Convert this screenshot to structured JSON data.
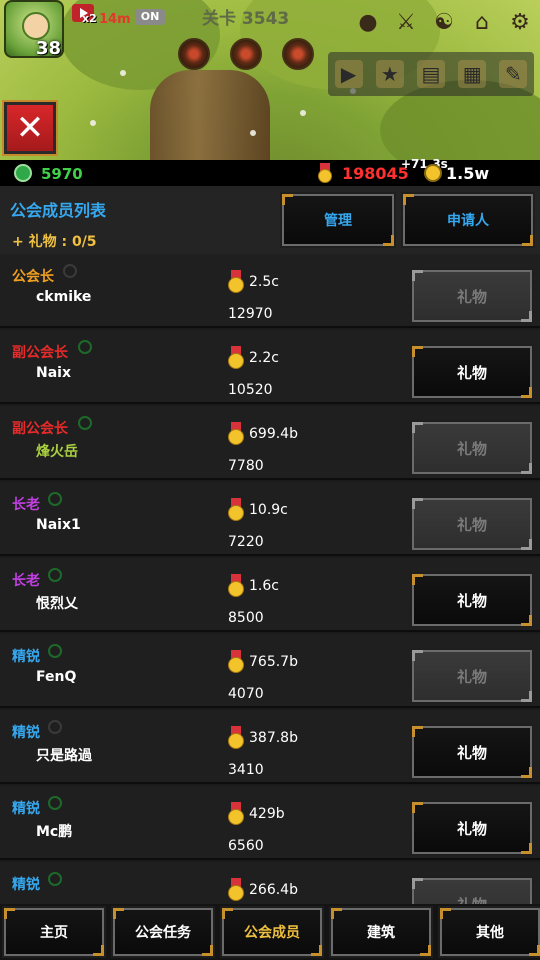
{
  "hud": {
    "player_level": "38",
    "speed_multiplier": "x2",
    "speed_time": "14m",
    "auto_toggle": "ON",
    "stage": "关卡 3543"
  },
  "currency": {
    "gems": "5970",
    "medals": "198045",
    "medal_rate": "+71.3s",
    "gold": "1.5w"
  },
  "guild": {
    "title": "公会成员列表",
    "gift_count": "+ 礼物 : 0/5",
    "manage_label": "管理",
    "applicants_label": "申请人"
  },
  "colors": {
    "leader": "#f0a020",
    "vice_leader": "#e82a2a",
    "elder": "#c040e0",
    "elite": "#36a8f0",
    "accent_blue": "#36a8f0",
    "gold_text": "#f0c040"
  },
  "members": [
    {
      "rank": "公会长",
      "name": "ckmike",
      "power": "2.5c",
      "score": "12970",
      "gift": "礼物",
      "online": false,
      "gift_enabled": false
    },
    {
      "rank": "副公会长",
      "name": "Naix",
      "power": "2.2c",
      "score": "10520",
      "gift": "礼物",
      "online": true,
      "gift_enabled": true
    },
    {
      "rank": "副公会长",
      "name": "烽火岳",
      "power": "699.4b",
      "score": "7780",
      "gift": "礼物",
      "online": true,
      "gift_enabled": false
    },
    {
      "rank": "长老",
      "name": "Naix1",
      "power": "10.9c",
      "score": "7220",
      "gift": "礼物",
      "online": true,
      "gift_enabled": false
    },
    {
      "rank": "长老",
      "name": "恨烈乂",
      "power": "1.6c",
      "score": "8500",
      "gift": "礼物",
      "online": true,
      "gift_enabled": true
    },
    {
      "rank": "精锐",
      "name": "FenQ",
      "power": "765.7b",
      "score": "4070",
      "gift": "礼物",
      "online": true,
      "gift_enabled": false
    },
    {
      "rank": "精锐",
      "name": "只是路過",
      "power": "387.8b",
      "score": "3410",
      "gift": "礼物",
      "online": false,
      "gift_enabled": true
    },
    {
      "rank": "精锐",
      "name": "Mc鹏",
      "power": "429b",
      "score": "6560",
      "gift": "礼物",
      "online": true,
      "gift_enabled": true
    },
    {
      "rank": "精锐",
      "name": "",
      "power": "266.4b",
      "score": "",
      "gift": "礼物",
      "online": true,
      "gift_enabled": false
    }
  ],
  "nav": {
    "home": "主页",
    "guild_tasks": "公会任务",
    "guild_members": "公会成员",
    "buildings": "建筑",
    "other": "其他"
  },
  "icons": {
    "close": "✕"
  }
}
